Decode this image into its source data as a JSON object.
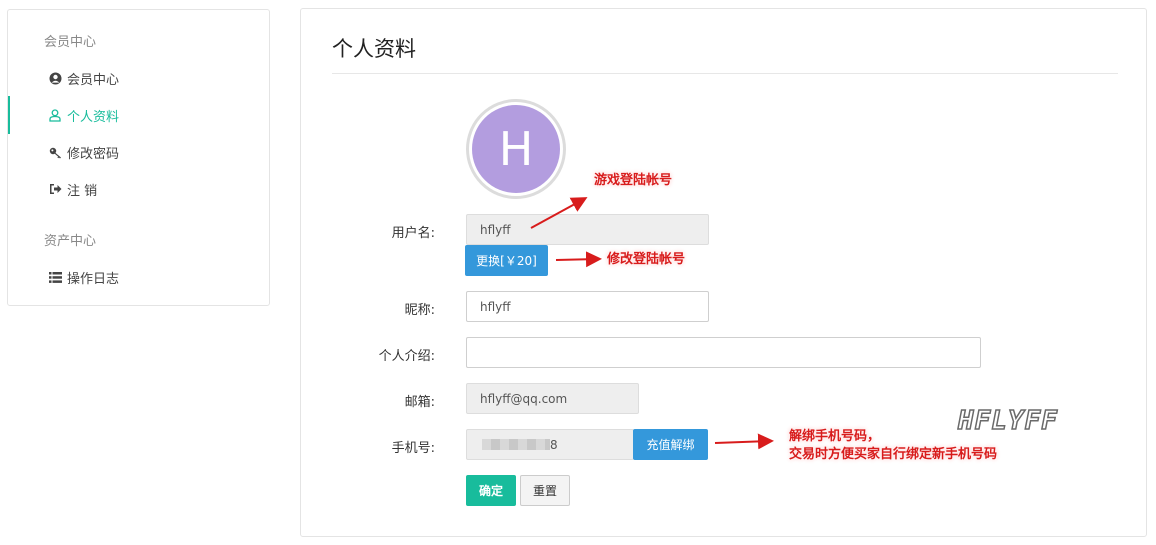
{
  "sidebar": {
    "group1": "会员中心",
    "items": [
      {
        "label": "会员中心",
        "icon": "user-circle-icon"
      },
      {
        "label": "个人资料",
        "icon": "user-icon",
        "active": true
      },
      {
        "label": "修改密码",
        "icon": "key-icon"
      },
      {
        "label": "注 销",
        "icon": "sign-out-icon"
      }
    ],
    "group2": "资产中心",
    "items2": [
      {
        "label": "操作日志",
        "icon": "list-icon"
      }
    ]
  },
  "main": {
    "title": "个人资料",
    "avatar_letter": "H",
    "avatar_color": "#b39ddf",
    "fields": {
      "username_label": "用户名:",
      "username_value": "hflyff",
      "change_button": "更换[￥20]",
      "nickname_label": "昵称:",
      "nickname_value": "hflyff",
      "intro_label": "个人介绍:",
      "intro_value": "",
      "email_label": "邮箱:",
      "email_value": "hflyff@qq.com",
      "phone_label": "手机号:",
      "phone_value_suffix": "8",
      "unbind_button": "充值解绑",
      "confirm_button": "确定",
      "reset_button": "重置"
    }
  },
  "annotations": {
    "note1": "游戏登陆帐号",
    "note2": "修改登陆帐号",
    "note3_line1": "解绑手机号码，",
    "note3_line2": "交易时方便买家自行绑定新手机号码",
    "watermark": "HFLYFF"
  },
  "colors": {
    "accent": "#18bc9c",
    "primary": "#3498db",
    "annotation": "#d81c1c"
  }
}
